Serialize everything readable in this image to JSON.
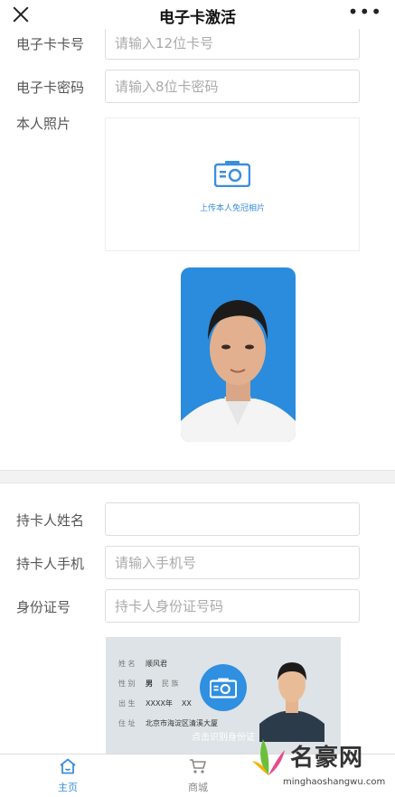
{
  "header": {
    "title": "电子卡激活"
  },
  "form": {
    "card_no_label": "电子卡卡号",
    "card_no_placeholder": "请输入12位卡号",
    "card_pwd_label": "电子卡密码",
    "card_pwd_placeholder": "请输入8位卡密码",
    "photo_label": "本人照片",
    "upload_text": "上传本人免冠相片",
    "holder_name_label": "持卡人姓名",
    "holder_phone_label": "持卡人手机",
    "holder_phone_placeholder": "请输入手机号",
    "id_label": "身份证号",
    "id_placeholder": "持卡人身份证号码"
  },
  "id_card": {
    "name_key": "姓 名",
    "name_val": "顺风君",
    "sex_key": "性 别",
    "sex_val": "男",
    "nation_key": "民 族",
    "birth_key": "出 生",
    "birth_val": "XXXX年",
    "birth_val2": "XX",
    "addr_key": "住 址",
    "addr_val": "北京市海淀区清溪大厦",
    "hint": "点击识别身份证"
  },
  "tabbar": {
    "home": "主页",
    "mall": "商城"
  },
  "watermark": {
    "name": "名豪网",
    "url": "minghaoshangwu.com"
  },
  "colors": {
    "accent": "#3b8edb",
    "card_bg": "#2b8bdc"
  }
}
